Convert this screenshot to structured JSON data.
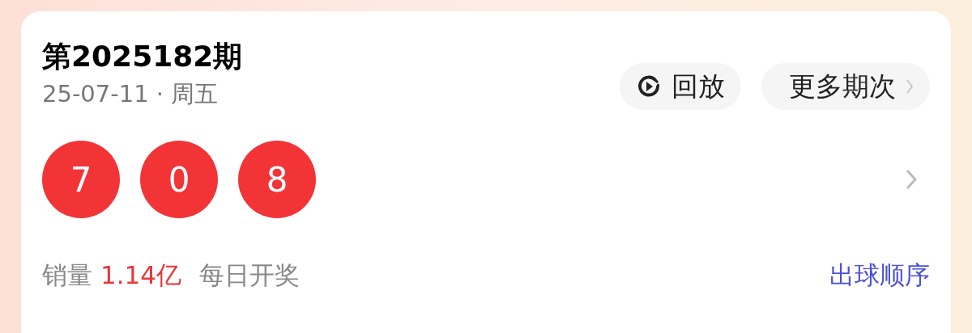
{
  "draw": {
    "title": "第2025182期",
    "date": "25-07-11 · 周五",
    "buttons": [
      {
        "kind": "replay",
        "label": "回放"
      },
      {
        "kind": "more",
        "label": "更多期次"
      }
    ],
    "balls": [
      "7",
      "0",
      "8"
    ],
    "sales_label": "销量",
    "sales_value": "1.14亿",
    "schedule": "每日开奖",
    "order_link": "出球顺序"
  }
}
